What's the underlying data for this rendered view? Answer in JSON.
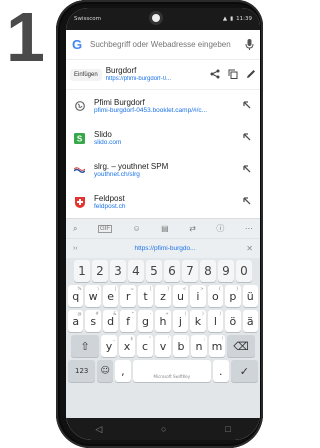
{
  "step_number": "1",
  "status": {
    "left": "Swisscom",
    "right": "11:39"
  },
  "url_bar": {
    "placeholder": "Suchbegriff oder Webadresse eingeben",
    "logo": "G"
  },
  "clipboard": {
    "paste_label": "Einfügen",
    "title": "Burgdorf",
    "url": "https://pfimi-burgdorf-0..."
  },
  "suggestions": [
    {
      "title": "Pfimi Burgdorf",
      "url": "pfimi-burgdorf-0453.booklet.camp/#/c...",
      "icon": "globe-icon"
    },
    {
      "title": "Slido",
      "url": "slido.com",
      "icon": "slido-icon"
    },
    {
      "title": "slrg. – youthnet SPM",
      "url": "youthnet.ch/slrg",
      "icon": "slrg-icon"
    },
    {
      "title": "Feldpost",
      "url": "feldpost.ch",
      "icon": "swiss-cross-icon"
    }
  ],
  "keyboard_suggestion": "https://pfimi-burgdo...",
  "keys": {
    "numbers": [
      "1",
      "2",
      "3",
      "4",
      "5",
      "6",
      "7",
      "8",
      "9",
      "0"
    ],
    "row1": [
      [
        "q",
        "%"
      ],
      [
        "w",
        "\\"
      ],
      [
        "e",
        "|"
      ],
      [
        "r",
        "="
      ],
      [
        "t",
        "["
      ],
      [
        "z",
        "]"
      ],
      [
        "u",
        "<"
      ],
      [
        "i",
        ">"
      ],
      [
        "o",
        "{"
      ],
      [
        "p",
        "}"
      ],
      [
        "ü",
        ""
      ]
    ],
    "row2": [
      [
        "a",
        "@"
      ],
      [
        "s",
        "#"
      ],
      [
        "d",
        "&"
      ],
      [
        "f",
        "*"
      ],
      [
        "g",
        "-"
      ],
      [
        "h",
        "+"
      ],
      [
        "j",
        "("
      ],
      [
        "k",
        ")"
      ],
      [
        "l",
        "/"
      ],
      [
        "ö",
        ""
      ],
      [
        "ä",
        ""
      ]
    ],
    "row3": [
      [
        "y",
        "_"
      ],
      [
        "x",
        "$"
      ],
      [
        "c",
        "\""
      ],
      [
        "v",
        "'"
      ],
      [
        "b",
        ":"
      ],
      [
        "n",
        ";"
      ],
      [
        "m",
        "!"
      ]
    ],
    "symbols_key": "123",
    "space_label": "Microsoft SwiftKey"
  },
  "colors": {
    "link": "#1a73e8",
    "keyboard_bg": "#e3e6e8"
  }
}
